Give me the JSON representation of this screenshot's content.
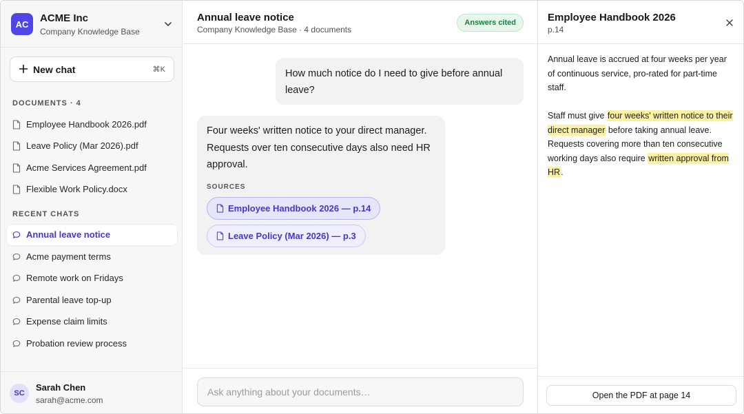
{
  "org": {
    "initials": "AC",
    "name": "ACME Inc",
    "subtitle": "Company Knowledge Base"
  },
  "new_chat": {
    "label": "New chat",
    "shortcut": "⌘K"
  },
  "documents": {
    "title": "DOCUMENTS · 4",
    "items": [
      {
        "name": "Employee Handbook 2026.pdf",
        "icon": "file-icon"
      },
      {
        "name": "Leave Policy (Mar 2026).pdf",
        "icon": "file-icon"
      },
      {
        "name": "Acme Services Agreement.pdf",
        "icon": "file-icon"
      },
      {
        "name": "Flexible Work Policy.docx",
        "icon": "file-icon"
      }
    ]
  },
  "recent_chats": {
    "title": "RECENT CHATS",
    "items": [
      {
        "label": "Annual leave notice",
        "active": true
      },
      {
        "label": "Acme payment terms"
      },
      {
        "label": "Remote work on Fridays"
      },
      {
        "label": "Parental leave top-up"
      },
      {
        "label": "Expense claim limits"
      },
      {
        "label": "Probation review process"
      }
    ]
  },
  "user": {
    "initials": "SC",
    "name": "Sarah Chen",
    "email": "sarah@acme.com"
  },
  "chat": {
    "title": "Annual leave notice",
    "subtitle": "Company Knowledge Base · 4 documents",
    "badge": "Answers cited",
    "messages": {
      "user": "How much notice do I need to give before annual leave?",
      "assistant": "Four weeks' written notice to your direct manager. Requests over ten consecutive days also need HR approval.",
      "sources_label": "SOURCES",
      "sources": [
        {
          "label": "Employee Handbook 2026 — p.14",
          "active": true
        },
        {
          "label": "Leave Policy (Mar 2026) — p.3"
        }
      ]
    },
    "composer_placeholder": "Ask anything about your documents…"
  },
  "panel": {
    "title": "Employee Handbook 2026",
    "page": "p.14",
    "para1": "Annual leave is accrued at four weeks per year of continuous service, pro-rated for part-time staff.",
    "para2": {
      "t1": "Staff must give ",
      "h1": "four weeks' written notice to their direct manager",
      "t2": " before taking annual leave. Requests covering more than ten consecutive working days also require ",
      "h2": "written approval from HR",
      "t3": "."
    },
    "open_button": "Open the PDF at page 14"
  },
  "colors": {
    "accent": "#4f46e5",
    "badge_green": "#16813a",
    "highlight": "#fdf2a4"
  }
}
